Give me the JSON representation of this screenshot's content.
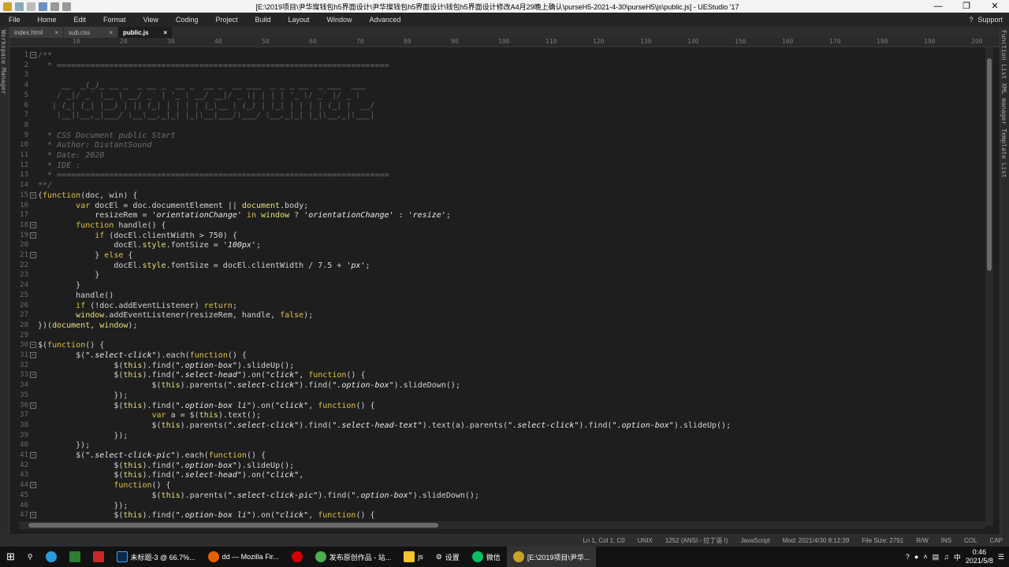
{
  "window": {
    "title": "[E:\\2019项目\\尹华璨钱包h5界面设计\\尹华璨钱包h5界面设计\\钱包h5界面设计修改A4月29晚上确认\\purseH5-2021-4-30\\purseH5\\js\\public.js] - UEStudio '17"
  },
  "menu": {
    "items": [
      "File",
      "Home",
      "Edit",
      "Format",
      "View",
      "Coding",
      "Project",
      "Build",
      "Layout",
      "Window",
      "Advanced"
    ],
    "support": "Support"
  },
  "side": {
    "left": "Workspace Manager",
    "right": "Function List  XML manager  Template List"
  },
  "tabs": [
    {
      "label": "index.html"
    },
    {
      "label": "sub.css"
    },
    {
      "label": "public.js"
    }
  ],
  "ruler": [
    "10",
    "20",
    "30",
    "40",
    "50",
    "60",
    "70",
    "80",
    "90",
    "100",
    "110",
    "120",
    "130",
    "140",
    "150",
    "160",
    "170",
    "180",
    "190",
    "200"
  ],
  "lines": [
    {
      "n": "1",
      "t": "/**"
    },
    {
      "n": "2",
      "t": "  * ======================================================================"
    },
    {
      "n": "3",
      "t": ""
    },
    {
      "n": "4",
      "t": "     __  _(_)_ __ _  _ __ _  __ _  __ _  __ ___  _ _ _ __  _ ___  ___"
    },
    {
      "n": "5",
      "t": "    / _|/ _` \\__ \\ __/ _` | '_ \\ __/ __|/ _ \\| | | | '_ \\/ _` |/ _ \\"
    },
    {
      "n": "6",
      "t": "   | (_| (_| |__) | || (_| | | | | |_\\__ \\ (_) | |_| | | | | (_| |  __/"
    },
    {
      "n": "7",
      "t": "    \\__|\\__,_|___/ \\__\\__,_|_| |_|\\__|___/\\___/ \\__,_|_| |_|\\__,_|\\___|"
    },
    {
      "n": "8",
      "t": ""
    },
    {
      "n": "9",
      "t": "  * CSS Document public Start"
    },
    {
      "n": "10",
      "t": "  * Author: DistantSound"
    },
    {
      "n": "11",
      "t": "  * Date: 2020"
    },
    {
      "n": "12",
      "t": "  * IDE :"
    },
    {
      "n": "13",
      "t": "  * ======================================================================"
    },
    {
      "n": "14",
      "t": "**/"
    },
    {
      "n": "15",
      "t": "(function(doc, win) {"
    },
    {
      "n": "16",
      "t": "        var docEl = doc.documentElement || document.body;"
    },
    {
      "n": "17",
      "t": "            resizeRem = 'orientationChange' in window ? 'orientationChange' : 'resize';"
    },
    {
      "n": "18",
      "t": "        function handle() {"
    },
    {
      "n": "19",
      "t": "            if (docEl.clientWidth > 750) {"
    },
    {
      "n": "20",
      "t": "                docEl.style.fontSize = '100px';"
    },
    {
      "n": "21",
      "t": "            } else {"
    },
    {
      "n": "22",
      "t": "                docEl.style.fontSize = docEl.clientWidth / 7.5 + 'px';"
    },
    {
      "n": "23",
      "t": "            }"
    },
    {
      "n": "24",
      "t": "        }"
    },
    {
      "n": "25",
      "t": "        handle()"
    },
    {
      "n": "26",
      "t": "        if (!doc.addEventListener) return;"
    },
    {
      "n": "27",
      "t": "        window.addEventListener(resizeRem, handle, false);"
    },
    {
      "n": "28",
      "t": "})(document, window);"
    },
    {
      "n": "29",
      "t": ""
    },
    {
      "n": "30",
      "t": "$(function() {"
    },
    {
      "n": "31",
      "t": "        $(\".select-click\").each(function() {"
    },
    {
      "n": "32",
      "t": "                $(this).find(\".option-box\").slideUp();"
    },
    {
      "n": "33",
      "t": "                $(this).find(\".select-head\").on(\"click\", function() {"
    },
    {
      "n": "34",
      "t": "                        $(this).parents(\".select-click\").find(\".option-box\").slideDown();"
    },
    {
      "n": "35",
      "t": "                });"
    },
    {
      "n": "36",
      "t": "                $(this).find(\".option-box li\").on(\"click\", function() {"
    },
    {
      "n": "37",
      "t": "                        var a = $(this).text();"
    },
    {
      "n": "38",
      "t": "                        $(this).parents(\".select-click\").find(\".select-head-text\").text(a).parents(\".select-click\").find(\".option-box\").slideUp();"
    },
    {
      "n": "39",
      "t": "                });"
    },
    {
      "n": "40",
      "t": "        });"
    },
    {
      "n": "41",
      "t": "        $(\".select-click-pic\").each(function() {"
    },
    {
      "n": "42",
      "t": "                $(this).find(\".option-box\").slideUp();"
    },
    {
      "n": "43",
      "t": "                $(this).find(\".select-head\").on(\"click\","
    },
    {
      "n": "44",
      "t": "                function() {"
    },
    {
      "n": "45",
      "t": "                        $(this).parents(\".select-click-pic\").find(\".option-box\").slideDown();"
    },
    {
      "n": "46",
      "t": "                });"
    },
    {
      "n": "47",
      "t": "                $(this).find(\".option-box li\").on(\"click\", function() {"
    }
  ],
  "status": {
    "pos": "Ln 1, Col 1, C0",
    "eol": "UNIX",
    "enc": "1252 (ANSI - 拉丁语 I)",
    "lang": "JavaScript",
    "mod": "Mod: 2021/4/30 8:12:39",
    "size": "File Size: 2791",
    "rw": "R/W",
    "ins": "INS",
    "col": "COL",
    "cap": "CAP"
  },
  "taskbar": {
    "items": [
      "未标题-3 @ 66.7%...",
      "dd — Mozilla Fir...",
      "",
      "发布原创作品 - 站...",
      "js",
      "设置",
      "微信",
      "[E:\\2019项目\\尹华..."
    ],
    "time": "0:46",
    "date": "2021/5/8",
    "ime": "中"
  }
}
